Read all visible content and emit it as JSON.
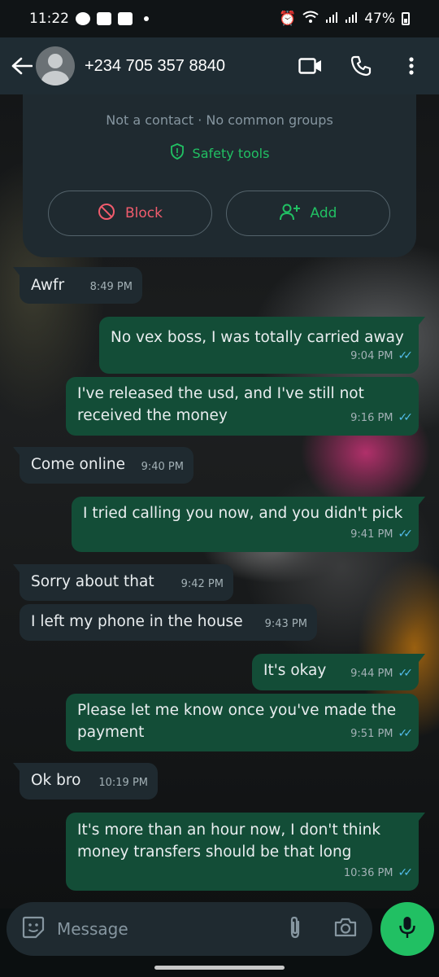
{
  "status_bar": {
    "time": "11:22",
    "battery": "47%"
  },
  "header": {
    "contact": "+234 705 357 8840"
  },
  "info_card": {
    "text": "Not a contact · No common groups",
    "safety_tools": "Safety tools",
    "block_label": "Block",
    "add_label": "Add"
  },
  "messages": [
    {
      "dir": "in",
      "text": "Awfr",
      "time": "8:49 PM"
    },
    {
      "dir": "out",
      "text": "No vex boss, I was totally carried away",
      "time": "9:04 PM"
    },
    {
      "dir": "out",
      "text_line1": "I've released the usd, and I've still not",
      "text_line2": "received the money",
      "time": "9:16 PM"
    },
    {
      "dir": "in",
      "text": "Come online",
      "time": "9:40 PM"
    },
    {
      "dir": "out",
      "text": "I tried calling you now, and you didn't pick",
      "time": "9:41 PM"
    },
    {
      "dir": "in",
      "text": "Sorry about that",
      "time": "9:42 PM"
    },
    {
      "dir": "in",
      "text": "I left my phone in the house",
      "time": "9:43 PM"
    },
    {
      "dir": "out",
      "text": "It's okay",
      "time": "9:44 PM"
    },
    {
      "dir": "out",
      "text_line1": "Please let me know once you've made the",
      "text_line2": "payment",
      "time": "9:51 PM"
    },
    {
      "dir": "in",
      "text": "Ok bro",
      "time": "10:19 PM"
    },
    {
      "dir": "out",
      "text_line1": "It's more than an hour now, I don't think",
      "text_line2": "money transfers should be that long",
      "time": "10:36 PM"
    }
  ],
  "composer": {
    "placeholder": "Message"
  },
  "colors": {
    "accent": "#21c063",
    "outgoing_bubble": "#134d37",
    "incoming_bubble": "#1f2a30",
    "read_ticks": "#53bdeb",
    "block": "#f15c6d"
  }
}
